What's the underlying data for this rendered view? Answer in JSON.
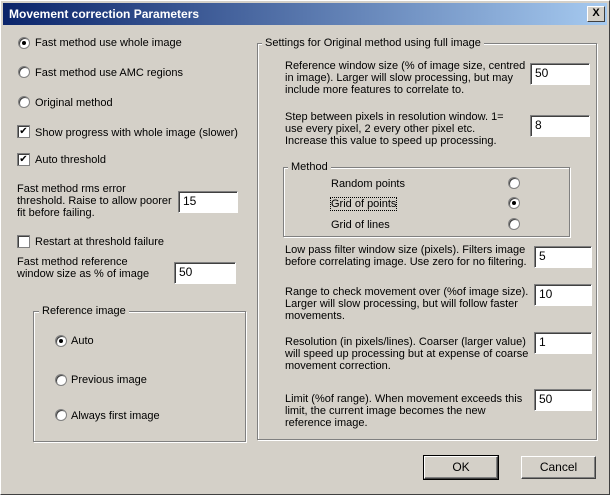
{
  "window": {
    "title": "Movement correction Parameters",
    "close": "X"
  },
  "left": {
    "radios": [
      {
        "label": "Fast method use whole image",
        "checked": true
      },
      {
        "label": "Fast method use AMC regions",
        "checked": false
      },
      {
        "label": "Original method",
        "checked": false
      }
    ],
    "show_progress": {
      "label": "Show progress with whole image (slower)",
      "checked": true
    },
    "auto_threshold": {
      "label": "Auto threshold",
      "checked": true
    },
    "rms_error": {
      "label": "Fast method rms error threshold.    Raise to allow poorer fit before failing.",
      "value": "15"
    },
    "restart": {
      "label": "Restart at threshold failure",
      "checked": false
    },
    "ref_window": {
      "label": "Fast method reference window size as % of image",
      "value": "50"
    },
    "reference_image": {
      "title": "Reference image",
      "options": [
        {
          "label": "Auto",
          "checked": true
        },
        {
          "label": "Previous image",
          "checked": false
        },
        {
          "label": "Always first image",
          "checked": false
        }
      ]
    }
  },
  "right": {
    "title": "Settings for Original method using full image",
    "ref_window_size": {
      "label": "Reference window size (% of image size, centred in image).  Larger will slow processing, but may include more features to correlate to.",
      "value": "50"
    },
    "step": {
      "label": "Step between pixels in resolution window.  1= use every pixel, 2 every other pixel etc. Increase this value to speed up processing.",
      "value": "8"
    },
    "method": {
      "title": "Method",
      "options": [
        {
          "label": "Random points",
          "checked": false
        },
        {
          "label": "Grid of points",
          "checked": true
        },
        {
          "label": "Grid of lines",
          "checked": false
        }
      ]
    },
    "low_pass": {
      "label": "Low pass filter window size (pixels).  Filters image before correlating image.  Use zero for no filtering.",
      "value": "5"
    },
    "range": {
      "label": "Range to check movement over (%of image size).  Larger will slow processing, but will follow faster movements.",
      "value": "10"
    },
    "resolution": {
      "label": "Resolution (in pixels/lines).  Coarser (larger value) will speed up processing but at expense of coarse movement correction.",
      "value": "1"
    },
    "limit": {
      "label": "Limit (%of range).  When movement exceeds this limit, the current image becomes the new reference image.",
      "value": "50"
    }
  },
  "buttons": {
    "ok": "OK",
    "cancel": "Cancel"
  }
}
